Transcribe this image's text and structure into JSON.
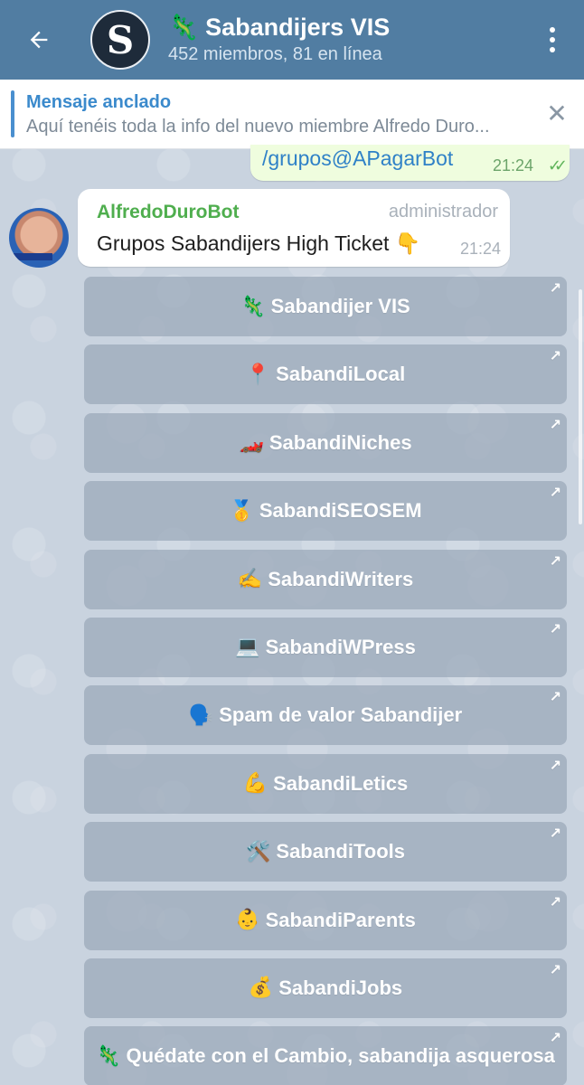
{
  "header": {
    "title": "Sabandijers VIS",
    "title_emoji": "🦎",
    "subtitle": "452 miembros, 81 en línea",
    "avatar_letter": "S"
  },
  "pinned": {
    "title": "Mensaje anclado",
    "text": "Aquí tenéis toda la info del nuevo miembre Alfredo Duro..."
  },
  "outgoing": {
    "text": "/grupos@APagarBot",
    "time": "21:24",
    "checks": "✓✓"
  },
  "incoming": {
    "sender": "AlfredoDuroBot",
    "role": "administrador",
    "text": "Grupos Sabandijers High Ticket 👇",
    "time": "21:24"
  },
  "keyboard": [
    {
      "emoji": "🦎",
      "label": "Sabandijer VIS"
    },
    {
      "emoji": "📍",
      "label": "SabandiLocal"
    },
    {
      "emoji": "🏎️",
      "label": "SabandiNiches"
    },
    {
      "emoji": "🥇",
      "label": "SabandiSEOSEM"
    },
    {
      "emoji": "✍️",
      "label": "SabandiWriters"
    },
    {
      "emoji": "💻",
      "label": "SabandiWPress"
    },
    {
      "emoji": "🗣️",
      "label": "Spam de valor Sabandijer"
    },
    {
      "emoji": "💪",
      "label": "SabandiLetics"
    },
    {
      "emoji": "🛠️",
      "label": "SabandiTools"
    },
    {
      "emoji": "👶",
      "label": "SabandiParents"
    },
    {
      "emoji": "💰",
      "label": "SabandiJobs"
    },
    {
      "emoji": "🦎",
      "label": "Quédate con el Cambio, sabandija asquerosa"
    }
  ],
  "colors": {
    "header": "#517da2",
    "sender": "#4fae4e",
    "link": "#2f81c7"
  }
}
